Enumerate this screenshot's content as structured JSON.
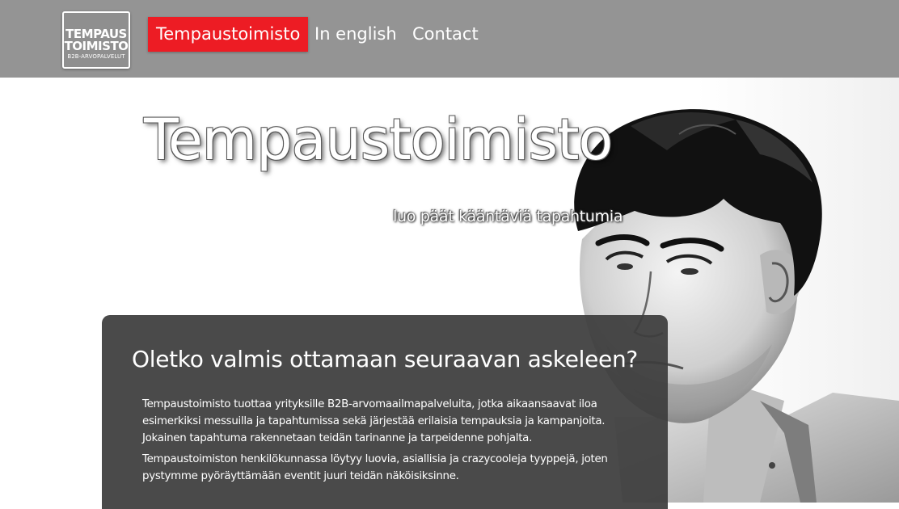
{
  "logo": {
    "line1": "TEMPAUS",
    "line2": "TOIMISTO",
    "line3": "B2B-ARVOPALVELUT"
  },
  "nav": {
    "items": [
      {
        "label": "Tempaustoimisto",
        "active": true
      },
      {
        "label": "In english",
        "active": false
      },
      {
        "label": "Contact",
        "active": false
      }
    ]
  },
  "hero": {
    "title": "Tempaustoimisto",
    "subtitle": "luo päät kääntäviä tapahtumia",
    "image_icon": "portrait-photo"
  },
  "content": {
    "heading": "Oletko valmis ottamaan seuraavan askeleen?",
    "paragraph1": "Tempaustoimisto tuottaa yrityksille B2B-arvomaailmapalveluita, jotka aikaansaavat iloa esimerkiksi messuilla ja tapahtumissa sekä järjestää erilaisia tempauksia ja kampanjoita. Jokainen tapahtuma rakennetaan teidän tarinanne ja tarpeidenne pohjalta.",
    "paragraph2": "Tempaustoimiston henkilökunnassa löytyy luovia, asiallisia ja crazycooleja tyyppejä, joten pystymme pyöräyttämään eventit juuri teidän näköisiksinne."
  },
  "colors": {
    "navbar": "#949494",
    "active_nav": "#ed1c24",
    "content_box": "#3c3c3c",
    "background": "#ffffff"
  }
}
